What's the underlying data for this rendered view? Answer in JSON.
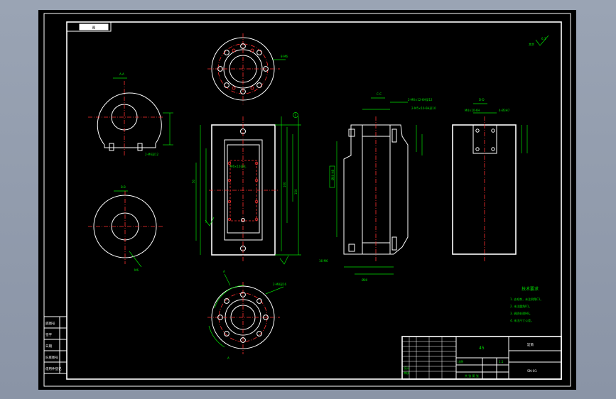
{
  "drawing": {
    "id_box": "图",
    "roughness": "6.3",
    "roughness_rest": "其余",
    "section_labels": {
      "a": "A-A",
      "b": "B-B",
      "c": "C-C",
      "d": "D-D"
    },
    "tech_req": {
      "title": "技术要求",
      "items": [
        "1. 去毛刺，未注倒角C1。",
        "2. 未注圆角R1。",
        "3. 调质处理HB。",
        "4. 未注尺寸公差。"
      ]
    },
    "title_block": {
      "material": "45",
      "part_name": "缸筒",
      "drawing_no": "SN-01",
      "scale_label": "比例",
      "scale_value": "1:1",
      "sheet": "共 张 第 张",
      "designer": "设计",
      "checker": "审核"
    },
    "side_stamp": [
      "底图号",
      "签字",
      "日期",
      "旧底图号",
      "借用件登记"
    ]
  }
}
